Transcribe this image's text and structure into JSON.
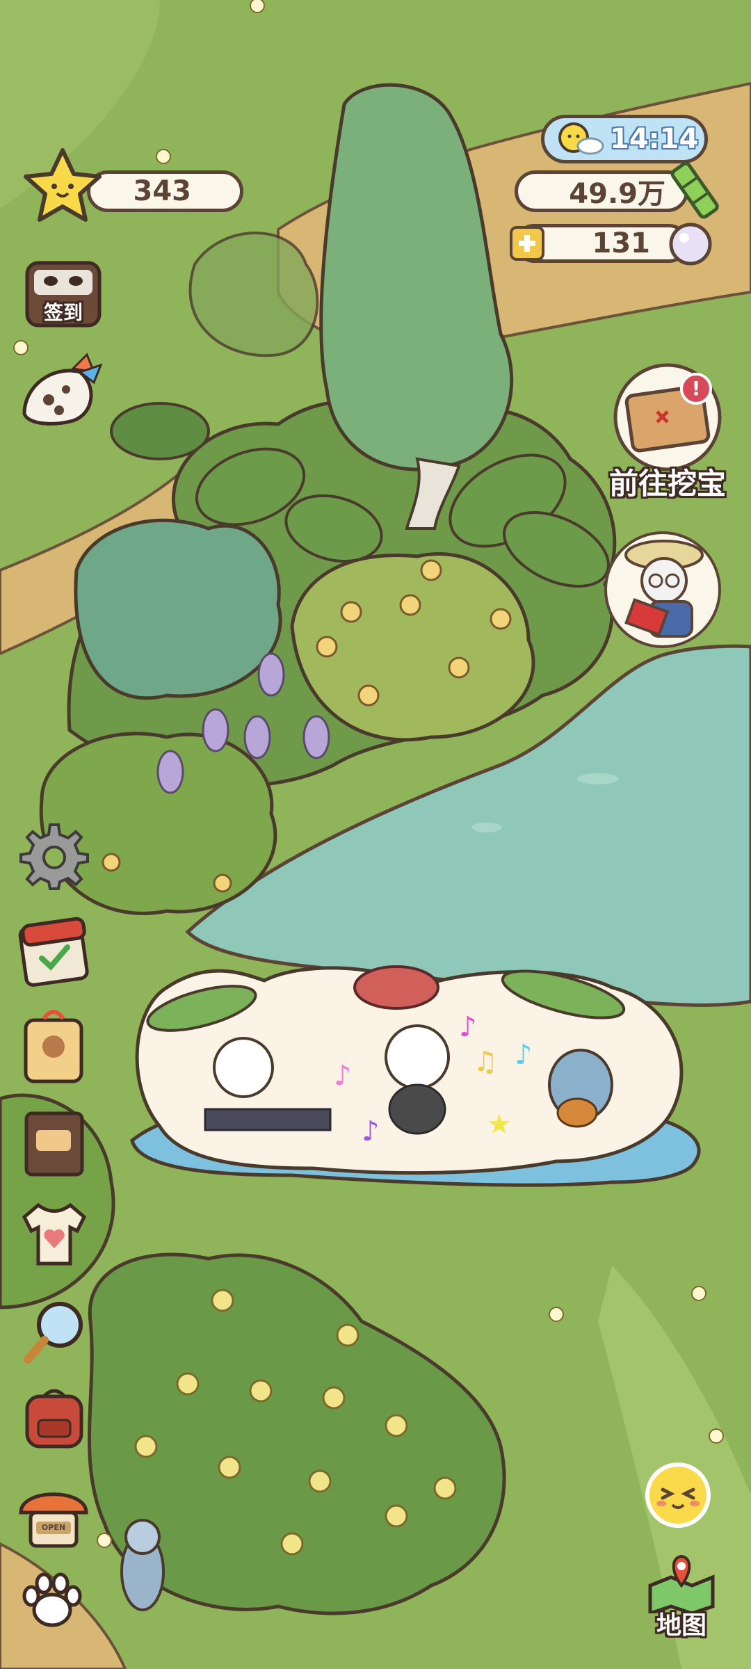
{
  "hud": {
    "stars": "343",
    "weather_icon": "sun-cloud-icon",
    "time": "14:14",
    "bamboo": "49.9万",
    "pearls": "131"
  },
  "buttons": {
    "checkin_label": "签到",
    "treasure_label": "前往挖宝",
    "map_label": "地图",
    "shop_sign": "OPEN"
  },
  "colors": {
    "grass": "#8fb45a",
    "path": "#d8b774",
    "pond": "#8fc7b8",
    "outline": "#5b4336",
    "time_pill": "#bfe2f4"
  }
}
